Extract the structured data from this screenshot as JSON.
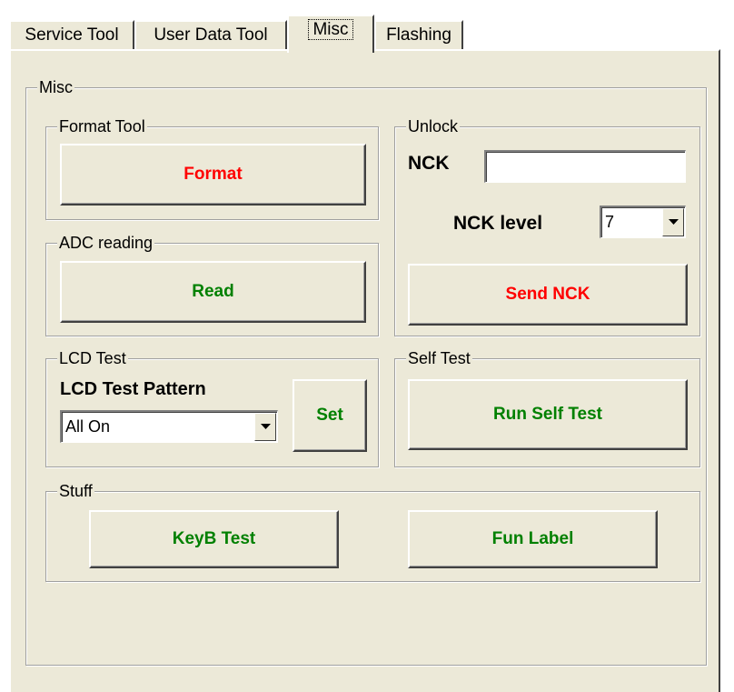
{
  "tabs": [
    {
      "label": "Service Tool"
    },
    {
      "label": "User Data Tool"
    },
    {
      "label": "Misc"
    },
    {
      "label": "Flashing"
    }
  ],
  "active_tab": "Misc",
  "misc_group": {
    "title": "Misc"
  },
  "format_tool": {
    "title": "Format Tool",
    "button": "Format"
  },
  "adc_reading": {
    "title": "ADC reading",
    "button": "Read"
  },
  "unlock": {
    "title": "Unlock",
    "nck_label": "NCK",
    "nck_value": "",
    "nck_level_label": "NCK level",
    "nck_level_value": "7",
    "send_button": "Send NCK"
  },
  "lcd_test": {
    "title": "LCD Test",
    "pattern_label": "LCD Test Pattern",
    "pattern_value": "All On",
    "set_button": "Set"
  },
  "self_test": {
    "title": "Self Test",
    "button": "Run Self Test"
  },
  "stuff": {
    "title": "Stuff",
    "keyb_button": "KeyB Test",
    "fun_button": "Fun Label"
  },
  "colors": {
    "background": "#ece9d8",
    "red_text": "#ff0000",
    "green_text": "#008000"
  },
  "icons": {
    "dropdown": "chevron-down-icon"
  }
}
